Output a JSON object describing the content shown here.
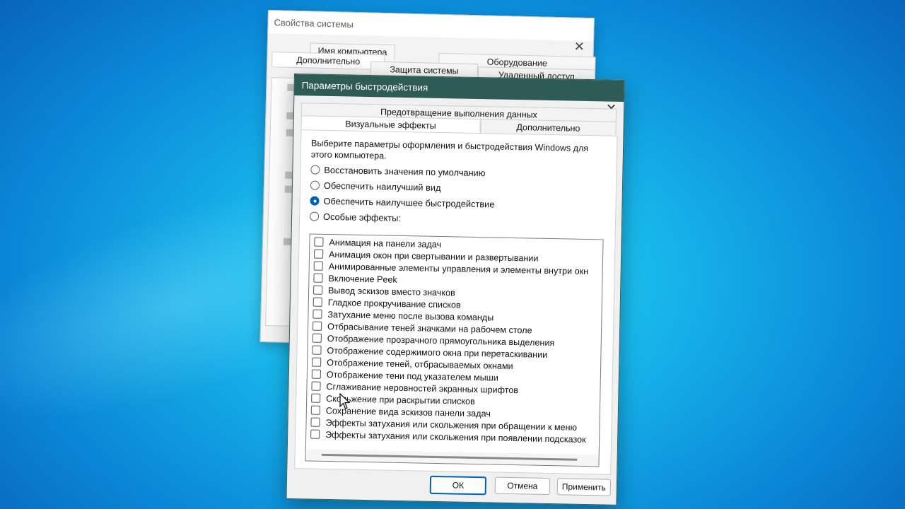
{
  "system_properties": {
    "title": "Свойства системы",
    "tabs": [
      "Имя компьютера",
      "Оборудование",
      "Дополнительно",
      "Защита системы",
      "Удаленный доступ"
    ]
  },
  "performance_options": {
    "title": "Параметры быстродействия",
    "tabs_top": [
      "Предотвращение выполнения данных"
    ],
    "tabs_bottom": [
      "Визуальные эффекты",
      "Дополнительно"
    ],
    "intro": "Выберите параметры оформления и быстродействия Windows для этого компьютера.",
    "radios": [
      {
        "label": "Восстановить значения по умолчанию",
        "checked": false
      },
      {
        "label": "Обеспечить наилучший вид",
        "checked": false
      },
      {
        "label": "Обеспечить наилучшее быстродействие",
        "checked": true
      },
      {
        "label": "Особые эффекты:",
        "checked": false
      }
    ],
    "effects": [
      "Анимация на панели задач",
      "Анимация окон при свертывании и развертывании",
      "Анимированные элементы управления и элементы внутри окн",
      "Включение Peek",
      "Вывод эскизов вместо значков",
      "Гладкое прокручивание списков",
      "Затухание меню после вызова команды",
      "Отбрасывание теней значками на рабочем столе",
      "Отображение прозрачного прямоугольника выделения",
      "Отображение содержимого окна при перетаскивании",
      "Отображение теней, отбрасываемых окнами",
      "Отображение тени под указателем мыши",
      "Сглаживание неровностей экранных шрифтов",
      "Скольжение при раскрытии списков",
      "Сохранение вида эскизов панели задач",
      "Эффекты затухания или скольжения при обращении к меню",
      "Эффекты затухания или скольжения при появлении подсказок"
    ],
    "buttons": {
      "ok": "ОК",
      "cancel": "Отмена",
      "apply": "Применить"
    }
  },
  "colors": {
    "title_bar": "#2f5b57",
    "accent": "#005fb8"
  },
  "icons": {
    "close": "close-icon",
    "cursor": "mouse-pointer-icon"
  }
}
